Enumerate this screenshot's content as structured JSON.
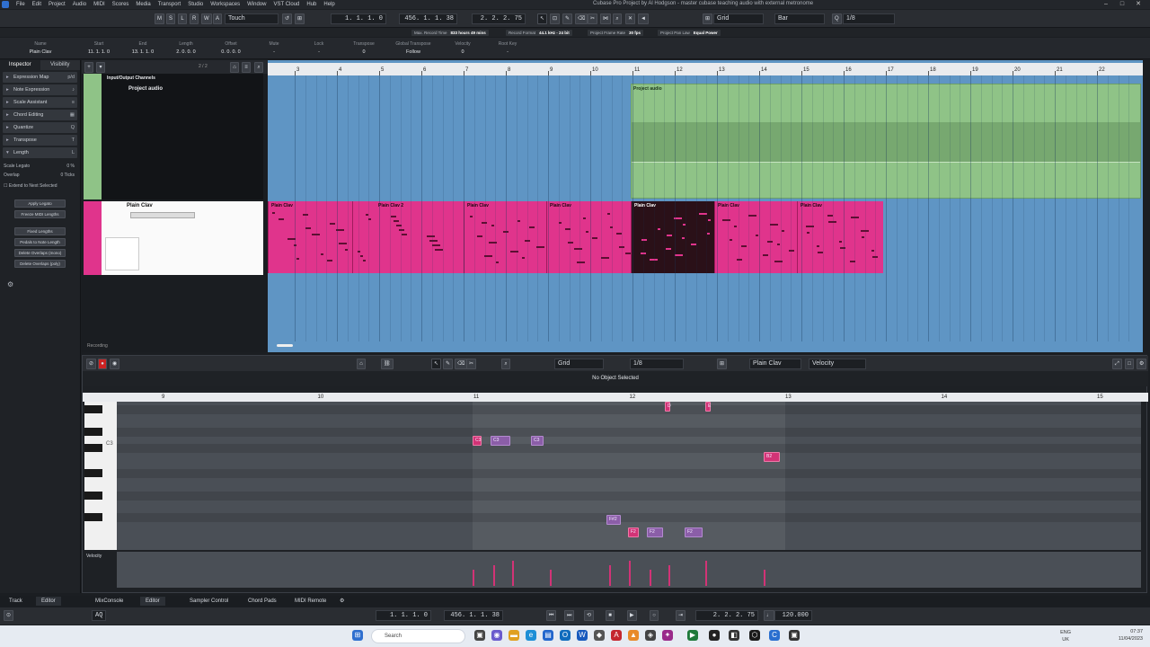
{
  "menu": {
    "items": [
      "File",
      "Edit",
      "Project",
      "Audio",
      "MIDI",
      "Scores",
      "Media",
      "Transport",
      "Studio",
      "Workspaces",
      "Window",
      "VST Cloud",
      "Hub",
      "Help"
    ],
    "window_title": "Cubase Pro Project by Al Hodgson - master cubase teaching audio with external metronome"
  },
  "toolbar": {
    "buttons": [
      "M",
      "S",
      "L",
      "R",
      "W",
      "A"
    ],
    "automation_mode": "Touch",
    "left_locator": "1. 1. 1.  0",
    "position": "456. 1. 1. 38",
    "right_locator": "2. 2. 2. 75",
    "snap_type": "Grid",
    "grid_type": "Bar",
    "quantize": "1/8"
  },
  "status": {
    "max_record_time_label": "Max. Record Time",
    "max_record_time": "833 hours 49 mins",
    "record_format_label": "Record Format",
    "record_format": "44.1 kHz - 24 bit",
    "frame_rate_label": "Project Frame Rate",
    "frame_rate": "30 fps",
    "pan_law_label": "Project Pan Law",
    "pan_law": "Equal Power"
  },
  "info_line": [
    {
      "key": "Name",
      "value": "Plain Clav"
    },
    {
      "key": "Start",
      "value": "11. 1. 1.  0"
    },
    {
      "key": "End",
      "value": "13. 1. 1.  0"
    },
    {
      "key": "Length",
      "value": "2. 0. 0.  0"
    },
    {
      "key": "Offset",
      "value": "0. 0. 0.  0"
    },
    {
      "key": "Mute",
      "value": "-"
    },
    {
      "key": "Lock",
      "value": "-"
    },
    {
      "key": "Transpose",
      "value": "0"
    },
    {
      "key": "Global Transpose",
      "value": "Follow"
    },
    {
      "key": "Velocity",
      "value": "0"
    },
    {
      "key": "Root Key",
      "value": "-"
    }
  ],
  "inspector": {
    "tabs": [
      "Inspector",
      "Visibility"
    ],
    "sections": [
      {
        "label": "Expression Map",
        "icon": "p/d"
      },
      {
        "label": "Note Expression",
        "icon": "♪"
      },
      {
        "label": "Scale Assistant",
        "icon": "≡"
      },
      {
        "label": "Chord Editing",
        "icon": "▦"
      },
      {
        "label": "Quantize",
        "icon": "Q"
      },
      {
        "label": "Transpose",
        "icon": "T"
      },
      {
        "label": "Length",
        "icon": "L"
      }
    ],
    "scale_legato_label": "Scale Legato",
    "scale_legato_value": "0 %",
    "overlap_label": "Overlap",
    "overlap_value": "0 Ticks",
    "extend_label": "Extend to Next Selected",
    "buttons": [
      "Apply Legato",
      "Freeze MIDI Lengths",
      "Fixed Lengths",
      "Pedals to Note Length",
      "Delete Overlaps (mono)",
      "Delete Overlaps (poly)"
    ]
  },
  "tracks": {
    "counter": "2 / 2",
    "folder_header": "Input/Output Channels",
    "folder_name": "Project audio",
    "instrument_name": "Plain Clav",
    "recording_label": "Recording"
  },
  "arrange": {
    "ruler": [
      "3",
      "4",
      "5",
      "6",
      "7",
      "8",
      "9",
      "10",
      "11",
      "12",
      "13",
      "14",
      "15",
      "16",
      "17",
      "18",
      "19",
      "20",
      "21",
      "22"
    ],
    "audio_event_name": "Project audio",
    "midi_parts": [
      "Plain Clav",
      "Plain Clav 2",
      "Plain Clav",
      "Plain Clav",
      "Plain Clav",
      "Plain Clav",
      "Plain Clav"
    ]
  },
  "editor": {
    "snap": "Grid",
    "quantize": "1/8",
    "part_name": "Plain Clav",
    "controller": "Velocity",
    "status": "No Object Selected",
    "ruler": [
      "9",
      "10",
      "11",
      "12",
      "13",
      "14",
      "15"
    ],
    "key_label": "C3",
    "velocity_label": "Velocity",
    "notes": [
      {
        "label": "C3",
        "color": "pink"
      },
      {
        "label": "C3",
        "color": "purple"
      },
      {
        "label": "C3",
        "color": "purple"
      },
      {
        "label": "D",
        "color": "pink"
      },
      {
        "label": "E",
        "color": "pink"
      },
      {
        "label": "B2",
        "color": "pink"
      },
      {
        "label": "F#2",
        "color": "purple"
      },
      {
        "label": "F2",
        "color": "pink"
      },
      {
        "label": "F2",
        "color": "purple"
      },
      {
        "label": "F2",
        "color": "purple"
      }
    ]
  },
  "bottom_tabs": [
    "Track",
    "Editor",
    "MixConsole",
    "Editor",
    "Sampler Control",
    "Chord Pads",
    "MIDI Remote"
  ],
  "bottom_transport": {
    "left_locator": "1. 1. 1.  0",
    "position": "456. 1. 1. 38",
    "right_locator": "2. 2. 2. 75",
    "tempo": "120.000",
    "aq": "AQ"
  },
  "taskbar": {
    "search_placeholder": "Search",
    "lang_1": "ENG",
    "lang_2": "UK",
    "time": "07:37",
    "date": "11/04/2023"
  },
  "colors": {
    "audio_track": "#8fc387",
    "midi_track": "#e0348c",
    "arrange_bg": "#5f95c4"
  }
}
